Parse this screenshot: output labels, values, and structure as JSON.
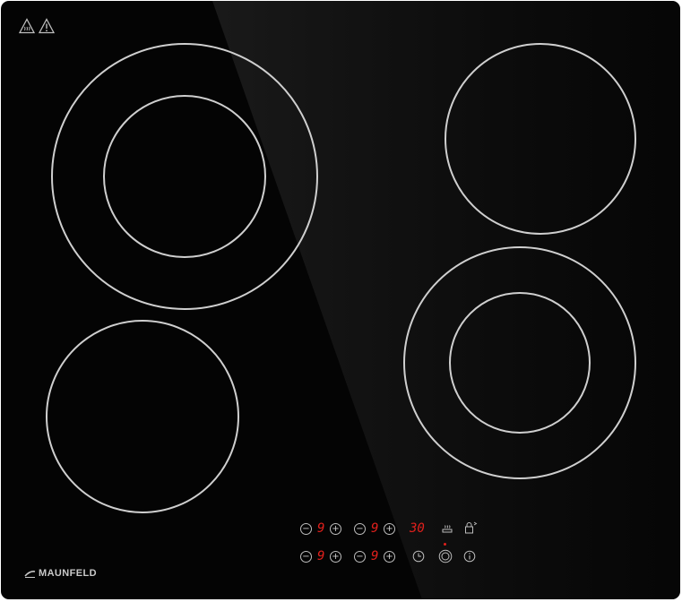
{
  "brand": {
    "name": "MAUNFELD"
  },
  "controls": {
    "top_row": {
      "zone_left_level": "9",
      "zone_right_level": "9",
      "timer_display": "30"
    },
    "bottom_row": {
      "zone_left_level": "9",
      "zone_right_level": "9"
    },
    "minus_symbol": "−",
    "plus_symbol": "+"
  },
  "colors": {
    "glass": "#040404",
    "ring": "#cfcfcf",
    "display_red": "#e0201c",
    "control_gray": "#bdbdbd"
  },
  "icons": [
    "hot-surface-icon",
    "warning-icon",
    "keep-warm-icon",
    "child-lock-icon",
    "timer-icon",
    "power-icon",
    "info-icon"
  ]
}
